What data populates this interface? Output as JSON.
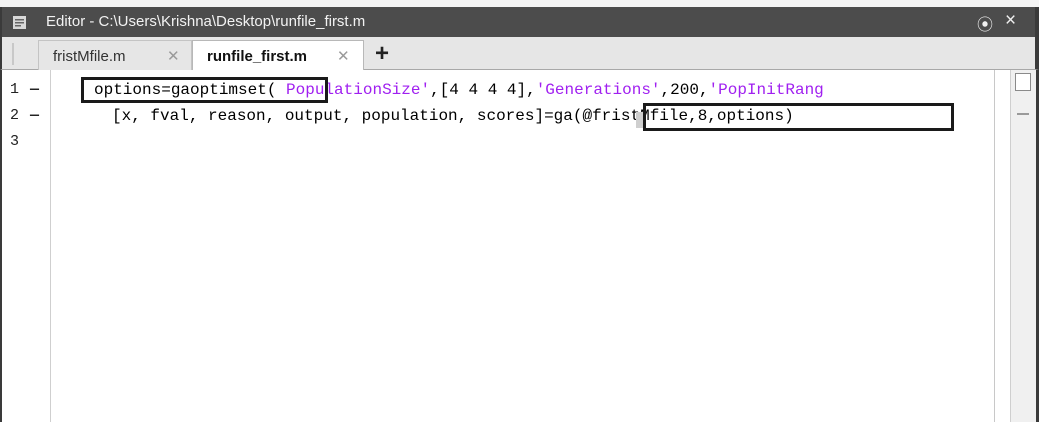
{
  "window": {
    "title": "Editor - C:\\Users\\Krishna\\Desktop\\runfile_first.m",
    "menu_icon": "⦿",
    "close_icon": "×"
  },
  "tabs": [
    {
      "label": "fristMfile.m",
      "close": "✕",
      "active": false
    },
    {
      "label": "runfile_first.m",
      "close": "✕",
      "active": true
    }
  ],
  "add_tab_label": "+",
  "editor": {
    "line_numbers": [
      "1",
      "2",
      "3"
    ],
    "line_markers": [
      "—",
      "—",
      ""
    ],
    "line1": {
      "part1": "options=gaoptimset(",
      "part2": " ",
      "str1": "PopulationSize'",
      "part3": ",[4 4 4 4],",
      "str2": "'Generations'",
      "part4": ",200,",
      "str3": "'PopInitRang"
    },
    "line2": {
      "part1": "[x, fval, reason, output, population, scores]=",
      "part2": "ga(@fristMfile,8,options)"
    },
    "line3": ""
  }
}
